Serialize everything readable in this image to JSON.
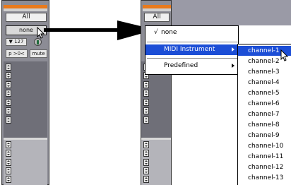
{
  "left_strip": {
    "all_label": "All",
    "none_label": "none",
    "volume_label": "▼ 127",
    "pan_label": "p >0<",
    "mute_label": "mute"
  },
  "right_strip": {
    "all_label": "All"
  },
  "output_menu": {
    "items": [
      {
        "label": "none",
        "checked": true
      },
      {
        "label": "MIDI Instrument",
        "has_submenu": true,
        "highlighted": true
      },
      {
        "label": "Predefined",
        "has_submenu": true
      }
    ],
    "check_glyph": "√"
  },
  "channel_submenu": {
    "items": [
      "channel-1",
      "channel-2",
      "channel-3",
      "channel-4",
      "channel-5",
      "channel-6",
      "channel-7",
      "channel-8",
      "channel-9",
      "channel-10",
      "channel-11",
      "channel-12",
      "channel-13"
    ],
    "highlighted_index": 0
  },
  "colors": {
    "highlight": "#1c4ed6",
    "strip_accent": "#e87a1c",
    "arrow": "#000000"
  },
  "icons": [
    "pointer-cursor-icon",
    "callout-arrow-icon",
    "submenu-arrow-icon",
    "stepper-arrows-icon",
    "knob-icon"
  ]
}
